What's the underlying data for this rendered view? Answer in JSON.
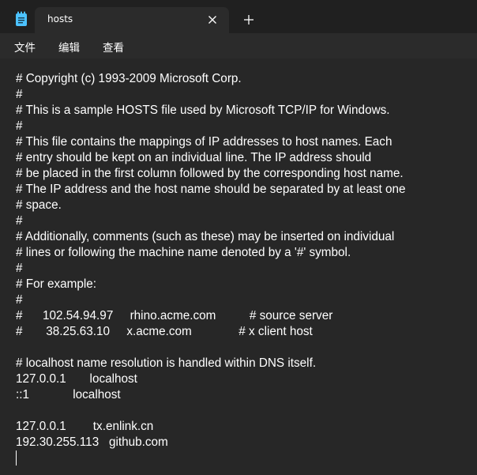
{
  "tab": {
    "title": "hosts"
  },
  "menu": {
    "items": [
      "文件",
      "编辑",
      "查看"
    ]
  },
  "icons": {
    "app": "notepad-icon",
    "close": "close-icon",
    "new_tab": "plus-icon"
  },
  "colors": {
    "background": "#202020",
    "tab_active": "#2b2b2b",
    "editor_bg": "#272727",
    "text": "#ffffff",
    "app_icon": "#4cc2ff"
  },
  "editor": {
    "lines": [
      "# Copyright (c) 1993-2009 Microsoft Corp.",
      "#",
      "# This is a sample HOSTS file used by Microsoft TCP/IP for Windows.",
      "#",
      "# This file contains the mappings of IP addresses to host names. Each",
      "# entry should be kept on an individual line. The IP address should",
      "# be placed in the first column followed by the corresponding host name.",
      "# The IP address and the host name should be separated by at least one",
      "# space.",
      "#",
      "# Additionally, comments (such as these) may be inserted on individual",
      "# lines or following the machine name denoted by a '#' symbol.",
      "#",
      "# For example:",
      "#",
      "#      102.54.94.97     rhino.acme.com          # source server",
      "#       38.25.63.10     x.acme.com              # x client host",
      "",
      "# localhost name resolution is handled within DNS itself.",
      "127.0.0.1       localhost",
      "::1             localhost",
      "",
      "127.0.0.1        tx.enlink.cn",
      "192.30.255.113   github.com"
    ]
  }
}
